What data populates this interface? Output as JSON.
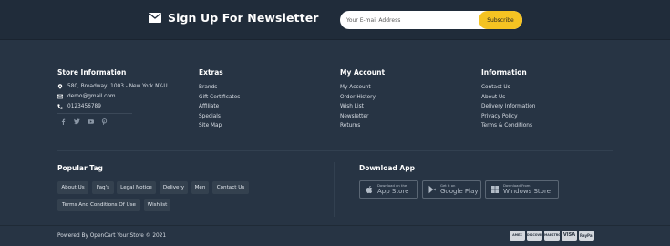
{
  "newsletter": {
    "icon": "envelope-icon",
    "title": "Sign Up For Newsletter",
    "placeholder": "Your E-mail Address",
    "button": "Subscribe"
  },
  "store_info": {
    "title": "Store Information",
    "address": "580, Broadway, 1003 - New York NY-U",
    "email": "demo@gmail.com",
    "phone": "0123456789",
    "socials": [
      "facebook-icon",
      "twitter-icon",
      "youtube-icon",
      "pinterest-icon"
    ]
  },
  "extras": {
    "title": "Extras",
    "links": [
      "Brands",
      "Gift Certificates",
      "Affiliate",
      "Specials",
      "Site Map"
    ]
  },
  "account": {
    "title": "My Account",
    "links": [
      "My Account",
      "Order History",
      "Wish List",
      "Newsletter",
      "Returns"
    ]
  },
  "information": {
    "title": "Information",
    "links": [
      "Contact Us",
      "About Us",
      "Delivery Information",
      "Privacy Policy",
      "Terms & Conditions"
    ]
  },
  "tags": {
    "title": "Popular Tag",
    "items": [
      "About Us",
      "Faq's",
      "Legal Notice",
      "Delivery",
      "Men",
      "Contact Us",
      "Terms And Conditions Of Use",
      "Wishlist"
    ]
  },
  "download": {
    "title": "Download App",
    "stores": [
      {
        "small": "Download on the",
        "big": "App Store",
        "icon": "apple-icon"
      },
      {
        "small": "Get it on",
        "big": "Google Play",
        "icon": "google-play-icon"
      },
      {
        "small": "Download From",
        "big": "Windows Store",
        "icon": "windows-icon"
      }
    ]
  },
  "footer": {
    "copyright": "Powered By OpenCart Your Store © 2021",
    "payments": [
      "AMEX",
      "DISCOVER",
      "MAESTRO",
      "VISA",
      "PayPal"
    ]
  },
  "colors": {
    "background": "#273444",
    "newsletter_bg": "#202c3a",
    "accent": "#f5c322"
  }
}
